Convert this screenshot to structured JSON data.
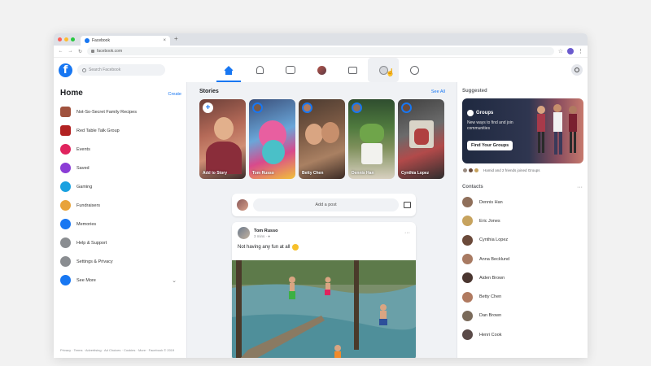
{
  "browser": {
    "tab_title": "Facebook",
    "url": "facebook.com",
    "new_tab_symbol": "+",
    "close_symbol": "×"
  },
  "header": {
    "logo_letter": "f",
    "search_placeholder": "Search Facebook",
    "nav_icons": [
      "home-icon",
      "notification-icon",
      "watch-icon",
      "friend-avatar-icon",
      "marketplace-icon",
      "groups-icon",
      "gaming-icon"
    ]
  },
  "left": {
    "title": "Home",
    "create": "Create",
    "items": [
      {
        "label": "Not-So-Secret Family Recipes",
        "icon": "group-photo-icon",
        "color": "#a0523d"
      },
      {
        "label": "Red Table Talk Group",
        "icon": "group-photo-icon",
        "color": "#b22222"
      },
      {
        "label": "Events",
        "icon": "events-icon",
        "color": "#e0245e"
      },
      {
        "label": "Saved",
        "icon": "saved-icon",
        "color": "#8b3dd6"
      },
      {
        "label": "Gaming",
        "icon": "gaming-icon",
        "color": "#1aa1e0"
      },
      {
        "label": "Fundraisers",
        "icon": "fundraisers-icon",
        "color": "#e8a33a"
      },
      {
        "label": "Memories",
        "icon": "memories-icon",
        "color": "#1877f2"
      },
      {
        "label": "Help & Support",
        "icon": "help-icon",
        "color": "#8a8d91"
      },
      {
        "label": "Settings & Privacy",
        "icon": "settings-icon",
        "color": "#8a8d91"
      },
      {
        "label": "See More",
        "icon": "see-more-icon",
        "color": "#1877f2"
      }
    ],
    "footer": "Privacy · Terms · Advertising · Ad Choices · Cookies · More · Facebook © 2019"
  },
  "stories": {
    "title": "Stories",
    "see_all": "See All",
    "items": [
      {
        "name": "Add to Story"
      },
      {
        "name": "Tom Russo"
      },
      {
        "name": "Betty Chen"
      },
      {
        "name": "Dennis Han"
      },
      {
        "name": "Cynthia Lopez"
      }
    ]
  },
  "composer": {
    "placeholder": "Add a post"
  },
  "post": {
    "author": "Tom Russo",
    "meta": "3 mins · ",
    "text": "Not having any fun at all",
    "more": "···"
  },
  "right": {
    "suggested_title": "Suggested",
    "promo": {
      "badge": "Groups",
      "text": "New ways to find and join communities",
      "button": "Find Your Groups"
    },
    "joined_text": "Hamid and 2 friends joined Groups",
    "contacts_title": "Contacts",
    "contacts_more": "···",
    "contacts": [
      {
        "name": "Dennis Han",
        "color": "#8f6f5a"
      },
      {
        "name": "Eric Jones",
        "color": "#c7a35e"
      },
      {
        "name": "Cynthia Lopez",
        "color": "#6b4a3a"
      },
      {
        "name": "Anna Becklund",
        "color": "#a87a62"
      },
      {
        "name": "Aiden Brown",
        "color": "#4a3630"
      },
      {
        "name": "Betty Chen",
        "color": "#b07a60"
      },
      {
        "name": "Dan Brown",
        "color": "#7a6a5a"
      },
      {
        "name": "Henri Cook",
        "color": "#5a4a48"
      }
    ]
  }
}
